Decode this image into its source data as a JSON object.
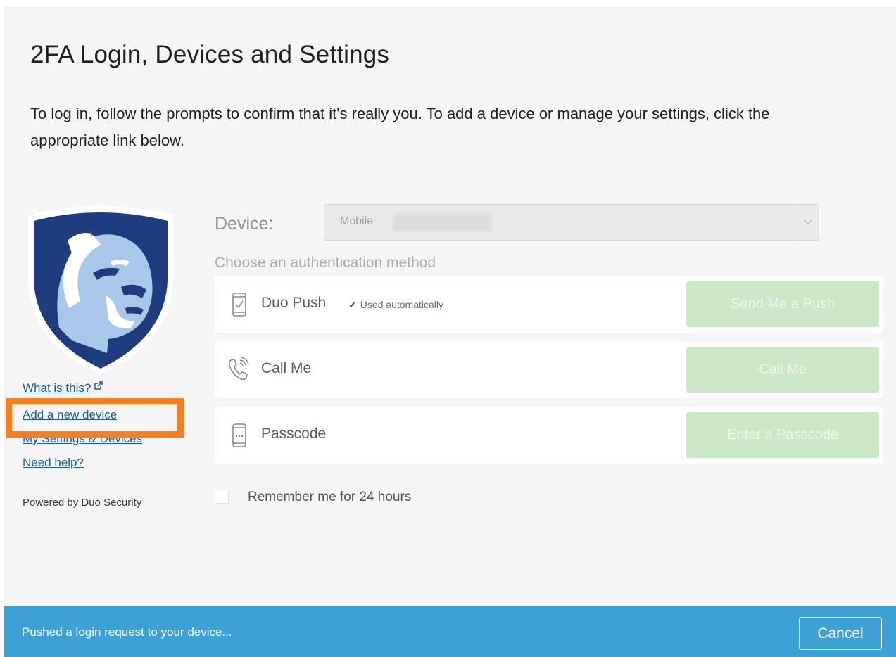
{
  "header": {
    "title": "2FA Login, Devices and Settings",
    "intro": "To log in, follow the prompts to confirm that it's really you. To add a device or manage your settings, click the appropriate link below."
  },
  "sidebar": {
    "links": [
      {
        "label": "What is this?"
      },
      {
        "label": "Add a new device"
      },
      {
        "label": "My Settings & Devices"
      },
      {
        "label": "Need help?"
      }
    ],
    "powered_by": "Powered by Duo Security"
  },
  "device": {
    "label": "Device:",
    "selected_value": "Mobile"
  },
  "auth": {
    "heading": "Choose an authentication method",
    "methods": [
      {
        "label": "Duo Push",
        "note": "Used automatically",
        "button": "Send Me a Push",
        "icon": "phone-check-icon"
      },
      {
        "label": "Call Me",
        "button": "Call Me",
        "icon": "phone-call-icon"
      },
      {
        "label": "Passcode",
        "button": "Enter a Passcode",
        "icon": "passcode-device-icon"
      }
    ],
    "remember_label": "Remember me for 24 hours"
  },
  "status": {
    "message": "Pushed a login request to your device...",
    "cancel_label": "Cancel"
  },
  "colors": {
    "status_bar": "#3da1d6",
    "highlight": "#f97e1f",
    "method_button": "#cde8c6",
    "link": "#1e5a9c",
    "shield_navy": "#1e3c7e"
  }
}
